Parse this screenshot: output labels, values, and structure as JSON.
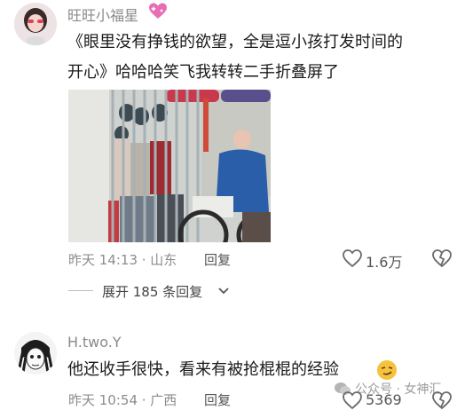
{
  "comment1": {
    "username": "旺旺小福星",
    "user_badge_icon": "sparkling-heart-icon",
    "text_line1": "《眼里没有挣钱的欲望，全是逗小孩打发时间的",
    "text_line2": "开心》哈哈哈笑飞我转转二手折叠屏了",
    "time": "昨天 14:13 · 山东",
    "reply_label": "回复",
    "like_count": "1.6万",
    "expand_label": "展开 185 条回复"
  },
  "comment2": {
    "username": "H.two.Y",
    "text": "他还收手很快，看来有被抢棍棍的经验",
    "emoji_icon": "smirking-face-icon",
    "time": "昨天 10:54 · 广西",
    "reply_label": "回复",
    "like_count": "5369"
  },
  "watermark": "公众号 · 女神汇"
}
